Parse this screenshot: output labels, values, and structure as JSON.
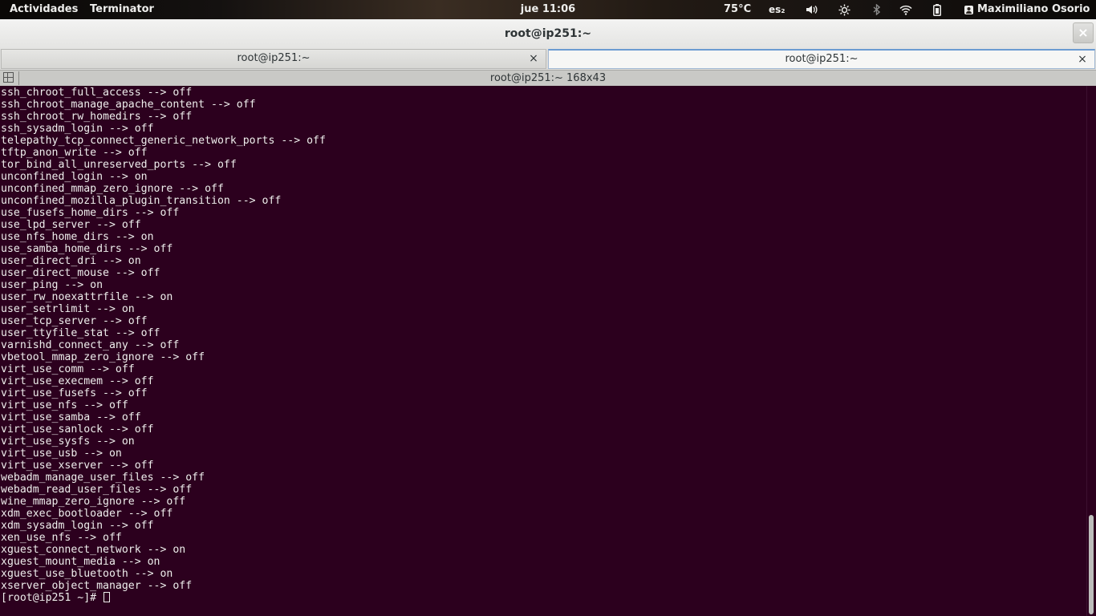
{
  "topbar": {
    "activities": "Actividades",
    "app_menu": "Terminator",
    "clock": "jue 11:06",
    "temperature": "75°C",
    "keyboard_layout": "es₂",
    "user": "Maximiliano Osorio",
    "icons": [
      "volume-icon",
      "brightness-icon",
      "bluetooth-icon",
      "wifi-icon",
      "battery-icon",
      "user-icon"
    ]
  },
  "window": {
    "title": "root@ip251:~",
    "close_glyph": "×"
  },
  "tabs": [
    {
      "label": "root@ip251:~",
      "active": false,
      "close_glyph": "×"
    },
    {
      "label": "root@ip251:~",
      "active": true,
      "close_glyph": "×"
    }
  ],
  "terminal": {
    "title": "root@ip251:~ 168x43",
    "colors": {
      "background": "#2c001e",
      "foreground": "#eeeeec"
    },
    "lines": [
      "ssh_chroot_full_access --> off",
      "ssh_chroot_manage_apache_content --> off",
      "ssh_chroot_rw_homedirs --> off",
      "ssh_sysadm_login --> off",
      "telepathy_tcp_connect_generic_network_ports --> off",
      "tftp_anon_write --> off",
      "tor_bind_all_unreserved_ports --> off",
      "unconfined_login --> on",
      "unconfined_mmap_zero_ignore --> off",
      "unconfined_mozilla_plugin_transition --> off",
      "use_fusefs_home_dirs --> off",
      "use_lpd_server --> off",
      "use_nfs_home_dirs --> on",
      "use_samba_home_dirs --> off",
      "user_direct_dri --> on",
      "user_direct_mouse --> off",
      "user_ping --> on",
      "user_rw_noexattrfile --> on",
      "user_setrlimit --> on",
      "user_tcp_server --> off",
      "user_ttyfile_stat --> off",
      "varnishd_connect_any --> off",
      "vbetool_mmap_zero_ignore --> off",
      "virt_use_comm --> off",
      "virt_use_execmem --> off",
      "virt_use_fusefs --> off",
      "virt_use_nfs --> off",
      "virt_use_samba --> off",
      "virt_use_sanlock --> off",
      "virt_use_sysfs --> on",
      "virt_use_usb --> on",
      "virt_use_xserver --> off",
      "webadm_manage_user_files --> off",
      "webadm_read_user_files --> off",
      "wine_mmap_zero_ignore --> off",
      "xdm_exec_bootloader --> off",
      "xdm_sysadm_login --> off",
      "xen_use_nfs --> off",
      "xguest_connect_network --> on",
      "xguest_mount_media --> on",
      "xguest_use_bluetooth --> on",
      "xserver_object_manager --> off"
    ],
    "prompt": "[root@ip251 ~]# "
  }
}
